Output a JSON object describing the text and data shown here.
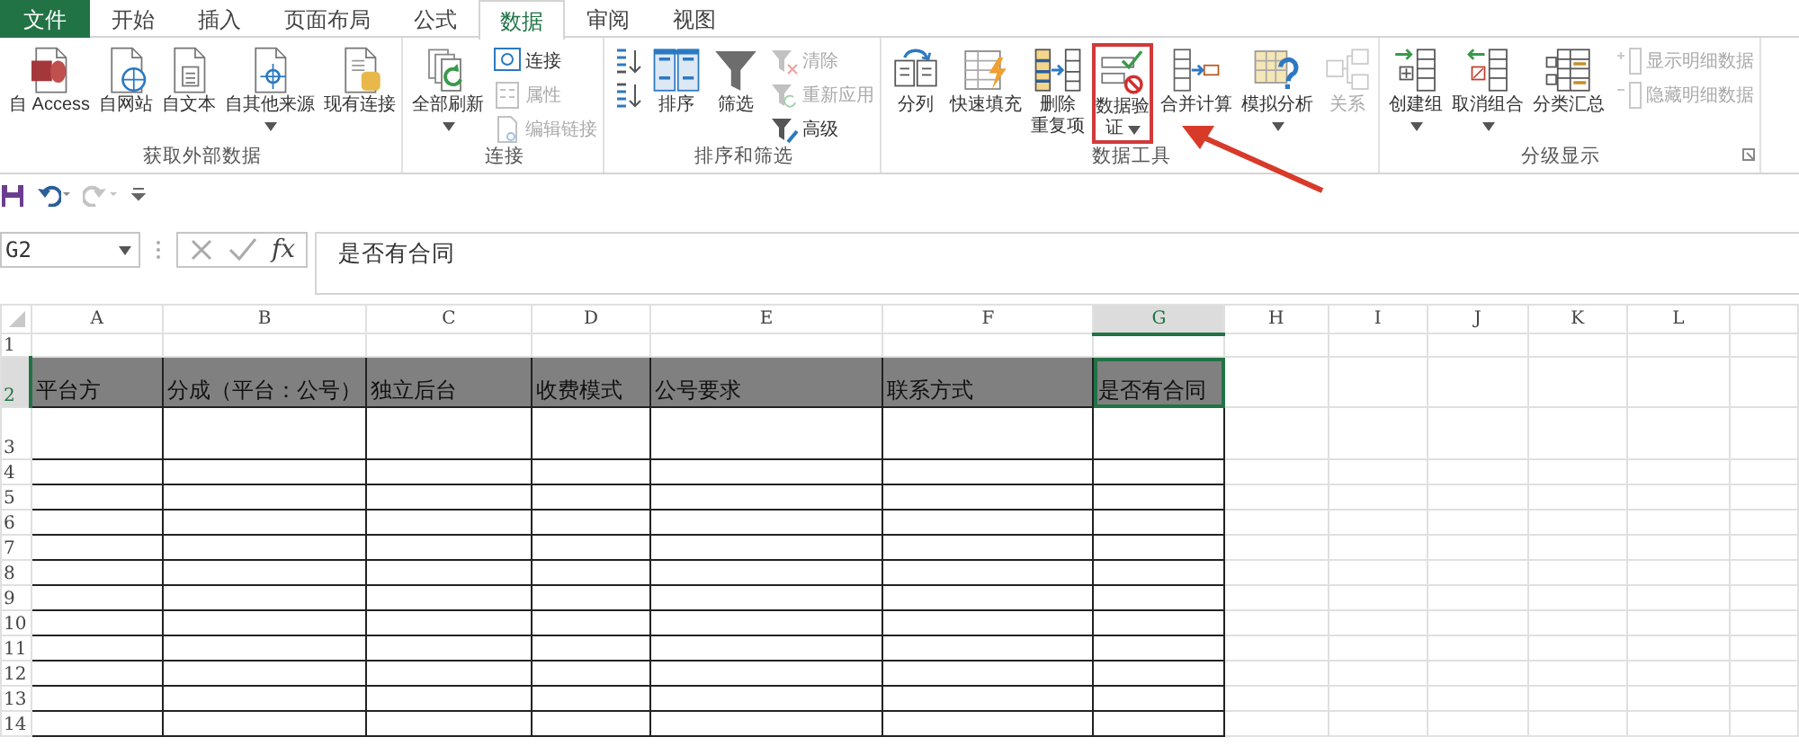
{
  "ribbon_tabs": [
    {
      "label": "文件",
      "kind": "file",
      "selected": false
    },
    {
      "label": "开始",
      "kind": "tab",
      "selected": false
    },
    {
      "label": "插入",
      "kind": "tab",
      "selected": false
    },
    {
      "label": "页面布局",
      "kind": "tab",
      "selected": false
    },
    {
      "label": "公式",
      "kind": "tab",
      "selected": false
    },
    {
      "label": "数据",
      "kind": "tab",
      "selected": true
    },
    {
      "label": "审阅",
      "kind": "tab",
      "selected": false
    },
    {
      "label": "视图",
      "kind": "tab",
      "selected": false
    }
  ],
  "ribbon_groups": [
    {
      "label": "获取外部数据",
      "items": [
        {
          "kind": "large",
          "label": "自 Access",
          "dropdown": false,
          "disabled": false,
          "highlighted": false
        },
        {
          "kind": "large",
          "label": "自网站",
          "dropdown": false,
          "disabled": false,
          "highlighted": false
        },
        {
          "kind": "large",
          "label": "自文本",
          "dropdown": false,
          "disabled": false,
          "highlighted": false
        },
        {
          "kind": "large",
          "label": "自其他来源",
          "dropdown": true,
          "disabled": false,
          "highlighted": false
        },
        {
          "kind": "large",
          "label": "现有连接",
          "dropdown": false,
          "disabled": false,
          "highlighted": false
        }
      ]
    },
    {
      "label": "连接",
      "items": [
        {
          "kind": "large",
          "label": "全部刷新",
          "dropdown": true,
          "disabled": false,
          "highlighted": false
        },
        {
          "kind": "stack",
          "buttons": [
            {
              "label": "连接",
              "disabled": false
            },
            {
              "label": "属性",
              "disabled": true
            },
            {
              "label": "编辑链接",
              "disabled": true
            }
          ]
        }
      ]
    },
    {
      "label": "排序和筛选",
      "items": [
        {
          "kind": "stack",
          "buttons": [
            {
              "disabled": false
            },
            {
              "disabled": false
            }
          ]
        },
        {
          "kind": "large",
          "label": "排序",
          "dropdown": false,
          "disabled": false,
          "highlighted": false
        },
        {
          "kind": "large",
          "label": "筛选",
          "dropdown": false,
          "disabled": false,
          "highlighted": false
        },
        {
          "kind": "stack",
          "buttons": [
            {
              "label": "清除",
              "disabled": true
            },
            {
              "label": "重新应用",
              "disabled": true
            },
            {
              "label": "高级",
              "disabled": false
            }
          ]
        }
      ]
    },
    {
      "label": "数据工具",
      "items": [
        {
          "kind": "large",
          "label": "分列",
          "dropdown": false,
          "disabled": false,
          "highlighted": false
        },
        {
          "kind": "large",
          "label": "快速填充",
          "dropdown": false,
          "disabled": false,
          "highlighted": false
        },
        {
          "kind": "large",
          "label": [
            "删除",
            "重复项"
          ],
          "dropdown": false,
          "disabled": false,
          "highlighted": false
        },
        {
          "kind": "large",
          "label": [
            "数据验",
            "证"
          ],
          "dropdown": true,
          "disabled": false,
          "highlighted": true
        },
        {
          "kind": "large",
          "label": "合并计算",
          "dropdown": false,
          "disabled": false,
          "highlighted": false
        },
        {
          "kind": "large",
          "label": "模拟分析",
          "dropdown": true,
          "disabled": false,
          "highlighted": false
        },
        {
          "kind": "large",
          "label": "关系",
          "dropdown": false,
          "disabled": true,
          "highlighted": false
        }
      ]
    },
    {
      "label": "分级显示",
      "launcher": true,
      "items": [
        {
          "kind": "large",
          "label": "创建组",
          "dropdown": true,
          "disabled": false,
          "highlighted": false
        },
        {
          "kind": "large",
          "label": "取消组合",
          "dropdown": true,
          "disabled": false,
          "highlighted": false
        },
        {
          "kind": "large",
          "label": "分类汇总",
          "dropdown": false,
          "disabled": false,
          "highlighted": false
        },
        {
          "kind": "stack",
          "buttons": [
            {
              "label": "显示明细数据",
              "disabled": true
            },
            {
              "label": "隐藏明细数据",
              "disabled": true
            }
          ]
        }
      ]
    }
  ],
  "quick_access": [
    {
      "disabled": false
    },
    {
      "disabled": false
    },
    {
      "disabled": true
    },
    {
      "disabled": false
    }
  ],
  "formula_bar": {
    "name_box": "G2",
    "function_label": "fx",
    "value": "是否有合同"
  },
  "sheet": {
    "columns": [
      {
        "label": "A",
        "selected": false
      },
      {
        "label": "B",
        "selected": false
      },
      {
        "label": "C",
        "selected": false
      },
      {
        "label": "D",
        "selected": false
      },
      {
        "label": "E",
        "selected": false
      },
      {
        "label": "F",
        "selected": false
      },
      {
        "label": "G",
        "selected": true
      },
      {
        "label": "H",
        "selected": false
      },
      {
        "label": "I",
        "selected": false
      },
      {
        "label": "J",
        "selected": false
      },
      {
        "label": "K",
        "selected": false
      },
      {
        "label": "L",
        "selected": false
      }
    ],
    "rows": [
      {
        "number": "1",
        "selected": false,
        "bordered": false,
        "shaded": false,
        "cells": []
      },
      {
        "number": "2",
        "selected": true,
        "bordered": true,
        "shaded": true,
        "cells": [
          "平台方",
          "分成（平台：公号）",
          "独立后台",
          "收费模式",
          "公号要求",
          "联系方式",
          "是否有合同"
        ]
      },
      {
        "number": "3",
        "selected": false,
        "bordered": true,
        "shaded": false,
        "cells": []
      },
      {
        "number": "4",
        "selected": false,
        "bordered": true,
        "shaded": false,
        "cells": []
      },
      {
        "number": "5",
        "selected": false,
        "bordered": true,
        "shaded": false,
        "cells": []
      },
      {
        "number": "6",
        "selected": false,
        "bordered": true,
        "shaded": false,
        "cells": []
      },
      {
        "number": "7",
        "selected": false,
        "bordered": true,
        "shaded": false,
        "cells": []
      },
      {
        "number": "8",
        "selected": false,
        "bordered": true,
        "shaded": false,
        "cells": []
      },
      {
        "number": "9",
        "selected": false,
        "bordered": true,
        "shaded": false,
        "cells": []
      },
      {
        "number": "10",
        "selected": false,
        "bordered": true,
        "shaded": false,
        "cells": []
      },
      {
        "number": "11",
        "selected": false,
        "bordered": true,
        "shaded": false,
        "cells": []
      },
      {
        "number": "12",
        "selected": false,
        "bordered": true,
        "shaded": false,
        "cells": []
      },
      {
        "number": "13",
        "selected": false,
        "bordered": true,
        "shaded": false,
        "cells": []
      },
      {
        "number": "14",
        "selected": false,
        "bordered": true,
        "shaded": false,
        "cells": []
      }
    ]
  },
  "annotation": {
    "kind": "arrow"
  }
}
